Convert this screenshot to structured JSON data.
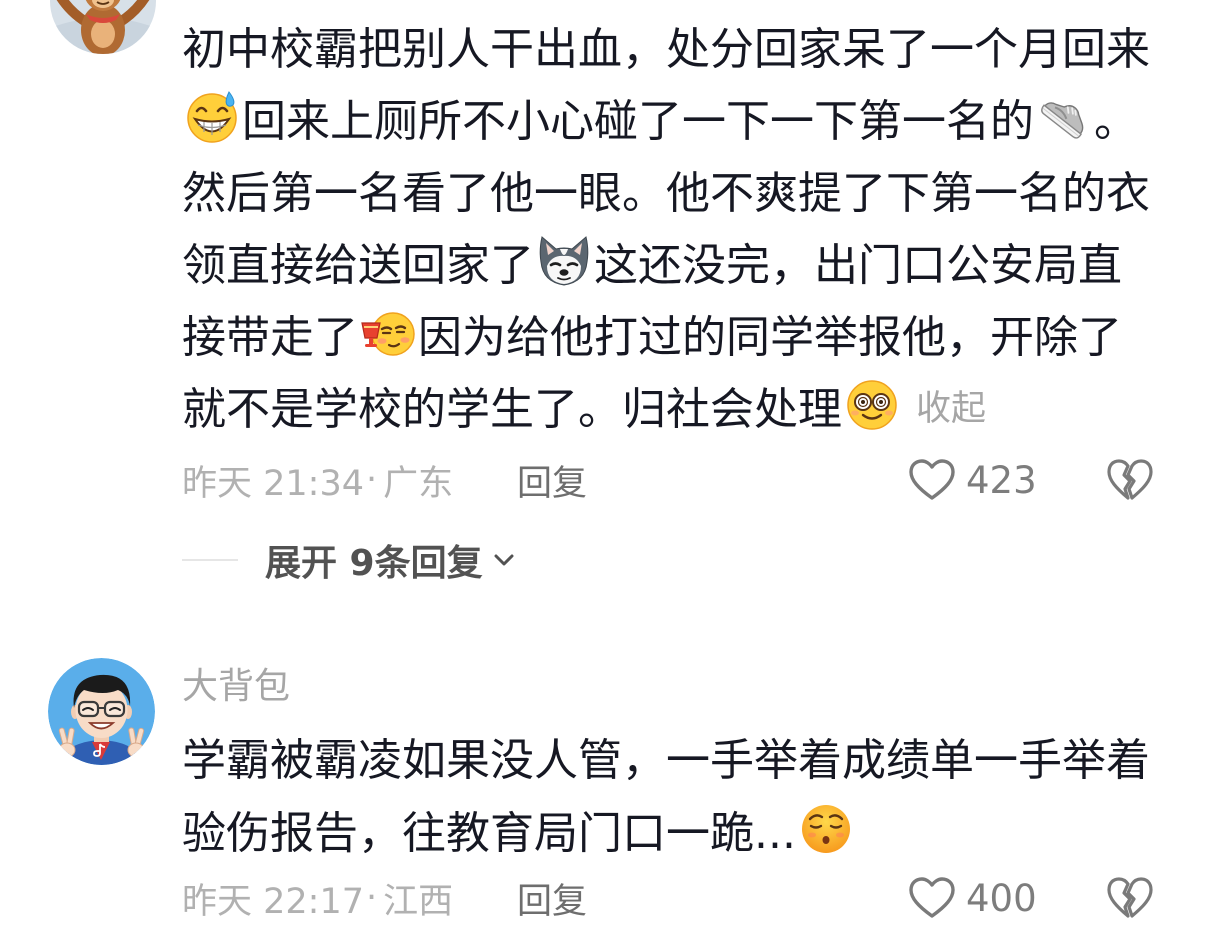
{
  "colors": {
    "background": "#ffffff",
    "text_primary": "#161823",
    "text_meta": "#b1b1b1",
    "text_muted": "#a6a6a6",
    "action_text": "#6e6e6e",
    "icon_gray": "#7a7a7a",
    "count_text": "#7d7d7d",
    "expand_text": "#525252",
    "divider": "#e6e6e6"
  },
  "comments": [
    {
      "avatar": "monkey-cartoon-avatar",
      "body_lines": [
        [
          {
            "text": "初中校霸把别人干出血，处分回家呆了一个月回来"
          }
        ],
        [
          {
            "emoji": "grinning-sweat-emoji"
          },
          {
            "text": "回来上厕所不小心碰了一下一下第一名的"
          },
          {
            "emoji": "sneaker-emoji"
          },
          {
            "text": "。"
          }
        ],
        [
          {
            "text": "然后第一名看了他一眼。他不爽提了下第一名的衣"
          }
        ],
        [
          {
            "text": "领直接给送回家了"
          },
          {
            "emoji": "husky-dog-emoji"
          },
          {
            "text": "这还没完，出门口公安局直"
          }
        ],
        [
          {
            "text": "接带走了"
          },
          {
            "emoji": "tipsy-drink-emoji"
          },
          {
            "text": "因为给他打过的同学举报他，开除了"
          }
        ],
        [
          {
            "text": "就不是学校的学生了。归社会处理"
          },
          {
            "emoji": "dazed-emoji"
          }
        ]
      ],
      "collapse_label": "收起",
      "time": "昨天 21:34",
      "separator": "·",
      "location": "广东",
      "reply_label": "回复",
      "like_icon": "heart-outline-icon",
      "like_count": "423",
      "dislike_icon": "broken-heart-icon",
      "expand_replies_label": "展开 9条回复",
      "expand_icon": "chevron-down-icon"
    },
    {
      "avatar": "cartoon-man-glasses-avatar",
      "username": "大背包",
      "body_lines": [
        [
          {
            "text": "学霸被霸凌如果没人管，一手举着成绩单一手举着"
          }
        ],
        [
          {
            "text": "验伤报告，往教育局门口一跪..."
          },
          {
            "emoji": "smug-raised-brows-emoji"
          }
        ]
      ],
      "time": "昨天 22:17",
      "separator": "·",
      "location": "江西",
      "reply_label": "回复",
      "like_icon": "heart-outline-icon",
      "like_count": "400",
      "dislike_icon": "broken-heart-icon"
    }
  ]
}
